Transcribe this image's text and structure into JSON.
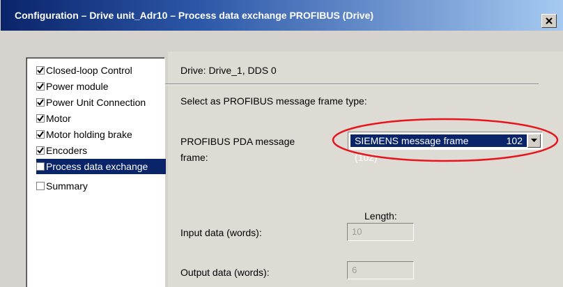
{
  "window": {
    "title": "Configuration – Drive unit_Adr10 – Process data exchange PROFIBUS (Drive)",
    "close_icon": "close-icon"
  },
  "nav": {
    "items": [
      {
        "label": "Closed-loop Control",
        "checked": true
      },
      {
        "label": "Power module",
        "checked": true
      },
      {
        "label": "Power Unit Connection",
        "checked": true
      },
      {
        "label": "Motor",
        "checked": true
      },
      {
        "label": "Motor holding brake",
        "checked": true
      },
      {
        "label": "Encoders",
        "checked": true
      },
      {
        "label": "Process data exchange",
        "checked": false,
        "selected": true
      },
      {
        "label": "Summary",
        "checked": false
      }
    ]
  },
  "main": {
    "drive_info": "Drive: Drive_1, DDS 0",
    "select_prompt": "Select as PROFIBUS message frame type:",
    "pda_label_line1": "PROFIBUS PDA message",
    "pda_label_line2": "frame:",
    "frame_select_value": "SIEMENS message frame",
    "frame_select_number": "102",
    "frame_select_overflow": "(102)",
    "length_header": "Length:",
    "input_label": "Input data (words):",
    "input_value": "10",
    "output_label": "Output data (words):",
    "output_value": "6"
  },
  "colors": {
    "highlight": "#0a246a",
    "annotation": "#e8141b"
  }
}
